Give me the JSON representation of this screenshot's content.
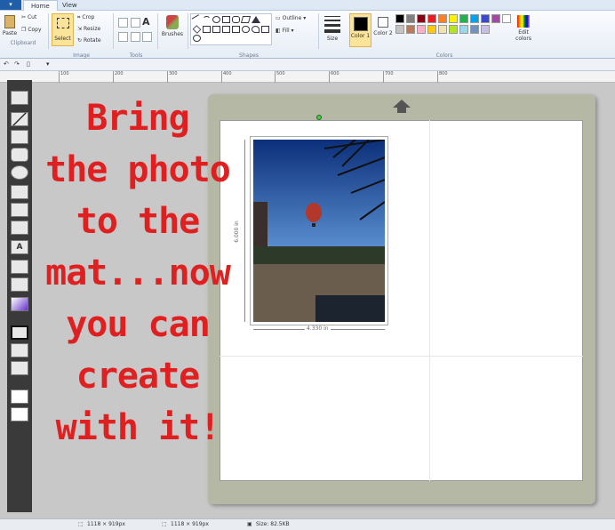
{
  "tabs": {
    "app": "▾",
    "home": "Home",
    "view": "View"
  },
  "clipboard": {
    "paste": "Paste",
    "cut": "Cut",
    "copy": "Copy",
    "label": "Clipboard"
  },
  "image": {
    "select": "Select",
    "crop": "Crop",
    "resize": "Resize",
    "rotate": "Rotate",
    "label": "Image"
  },
  "tools": {
    "label": "Tools",
    "text_tool": "A"
  },
  "brushes": {
    "label": "Brushes"
  },
  "shapes": {
    "outline": "Outline",
    "fill": "Fill",
    "label": "Shapes"
  },
  "size": {
    "label": "Size"
  },
  "colors": {
    "color1": "Color 1",
    "color2": "Color 2",
    "edit": "Edit colors",
    "label": "Colors",
    "palette": [
      "#000000",
      "#7f7f7f",
      "#880015",
      "#ed1c24",
      "#ff7f27",
      "#fff200",
      "#22b14c",
      "#00a2e8",
      "#3f48cc",
      "#a349a4",
      "#ffffff",
      "#c3c3c3",
      "#b97a57",
      "#ffaec9",
      "#ffc90e",
      "#efe4b0",
      "#b5e61d",
      "#99d9ea",
      "#7092be",
      "#c8bfe7"
    ]
  },
  "ruler": [
    "100",
    "200",
    "300",
    "400",
    "500",
    "600",
    "700",
    "800"
  ],
  "overlay_lines": [
    "Bring",
    "the photo",
    "to the",
    "mat...now",
    "you can",
    "create",
    "with it!"
  ],
  "photo": {
    "height": "6.000 in",
    "width": "4.330 in"
  },
  "status": {
    "size1": "1118 × 919px",
    "size2": "1118 × 919px",
    "filesize": "Size: 82.5KB"
  }
}
